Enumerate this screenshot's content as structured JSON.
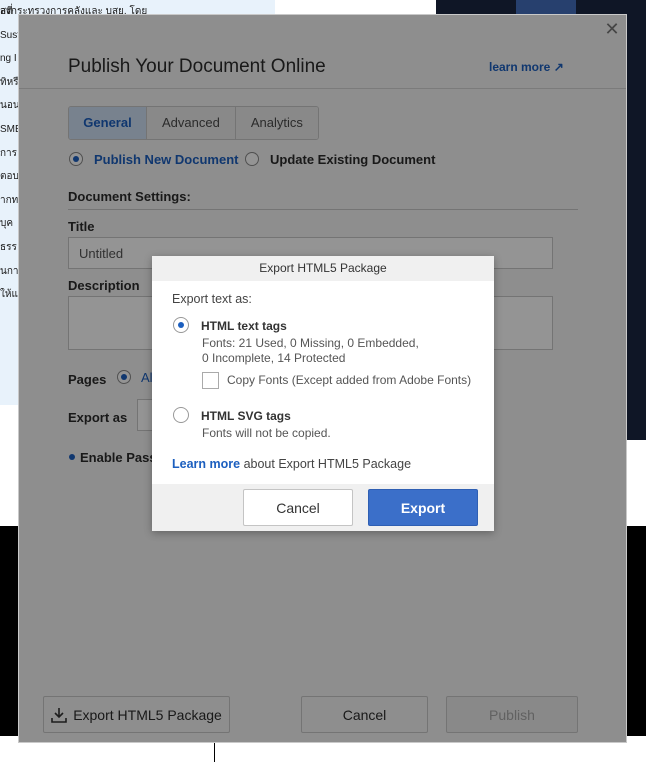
{
  "background": {
    "doc_lines": [
      "องกระทรวงการคลังและ บสย. โดย",
      "สที่",
      "Sust",
      "ng I",
      "ทิหรือ",
      "นอน",
      "",
      "SME",
      "การ",
      "ตอบ",
      "ากท",
      "บุค",
      "ธรร",
      "",
      "นการ",
      "ให้แก"
    ]
  },
  "dialog": {
    "title": "Publish Your Document Online",
    "learn_more": "learn more ↗",
    "tabs": [
      "General",
      "Advanced",
      "Analytics"
    ],
    "publish_new": "Publish New Document",
    "update_existing": "Update Existing Document",
    "document_settings": "Document Settings:",
    "title_label": "Title",
    "title_value": "Untitled",
    "description_label": "Description",
    "pages_label": "Pages",
    "pages_value": "Al",
    "export_as_label": "Export as",
    "enable_password": "Enable Passw",
    "footer": {
      "export_html5": "Export HTML5 Package",
      "cancel": "Cancel",
      "publish": "Publish"
    }
  },
  "modal": {
    "title": "Export HTML5 Package",
    "export_text_as": "Export text as:",
    "html_text_tags": "HTML text tags",
    "fonts_line1": "Fonts: 21 Used, 0 Missing, 0 Embedded,",
    "fonts_line2": "0 Incomplete, 14 Protected",
    "copy_fonts": "Copy Fonts (Except added from Adobe Fonts)",
    "html_svg_tags": "HTML SVG tags",
    "fonts_not_copied": "Fonts will not be copied.",
    "learn_more_link": "Learn more",
    "learn_more_rest": " about Export HTML5 Package",
    "cancel": "Cancel",
    "export": "Export"
  },
  "colors": {
    "accent": "#1c5fbf",
    "export_button": "#3b6fc9"
  }
}
